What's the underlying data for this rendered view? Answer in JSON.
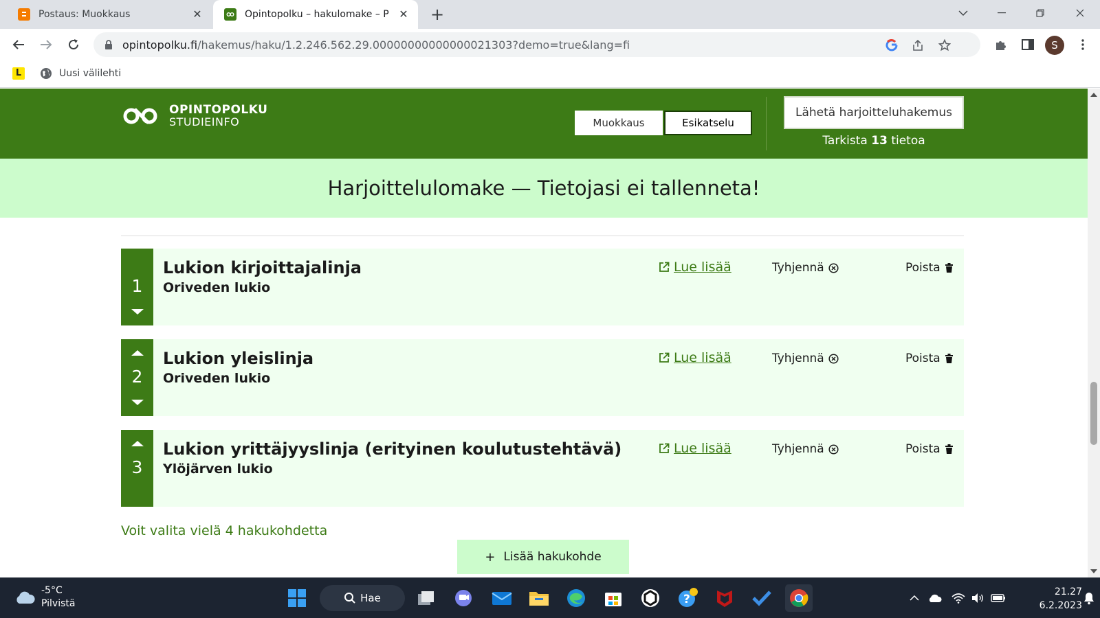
{
  "browser": {
    "tabs": [
      {
        "title": "Postaus: Muokkaus",
        "favicon": "blogger-icon"
      },
      {
        "title": "Opintopolku – hakulomake – Per",
        "favicon": "opintopolku-icon"
      }
    ],
    "url_host": "opintopolku.fi",
    "url_path": "/hakemus/haku/1.2.246.562.29.00000000000000021303?demo=true&lang=fi",
    "profile_initial": "S",
    "bookmarks": [
      {
        "label": "",
        "icon": "bookmark-app-icon"
      },
      {
        "label": "Uusi välilehti",
        "icon": "globe-icon"
      }
    ]
  },
  "header": {
    "logo_line1": "OPINTOPOLKU",
    "logo_line2": "STUDIEINFO",
    "mode_edit": "Muokkaus",
    "mode_preview": "Esikatselu",
    "send_button": "Lähetä harjoitteluhakemus",
    "check_prefix": "Tarkista",
    "check_count": "13",
    "check_suffix": "tietoa"
  },
  "banner": "Harjoittelulomake — Tietojasi ei tallenneta!",
  "applications": [
    {
      "number": "1",
      "title": "Lukion kirjoittajalinja",
      "school": "Oriveden lukio",
      "read_more": "Lue lisää",
      "clear": "Tyhjennä",
      "remove": "Poista"
    },
    {
      "number": "2",
      "title": "Lukion yleislinja",
      "school": "Oriveden lukio",
      "read_more": "Lue lisää",
      "clear": "Tyhjennä",
      "remove": "Poista"
    },
    {
      "number": "3",
      "title": "Lukion yrittäjyyslinja (erityinen koulutustehtävä)",
      "school": "Ylöjärven lukio",
      "read_more": "Lue lisää",
      "clear": "Tyhjennä",
      "remove": "Poista"
    }
  ],
  "remaining_text": "Voit valita vielä 4 hakukohdetta",
  "add_button": "Lisää hakukohde",
  "taskbar": {
    "temperature": "-5°C",
    "condition": "Pilvistä",
    "search_label": "Hae",
    "time": "21.27",
    "date": "6.2.2023"
  },
  "colors": {
    "brand_green": "#3d7b16",
    "banner_green": "#ccfccc",
    "card_bg": "#f0fff0"
  }
}
